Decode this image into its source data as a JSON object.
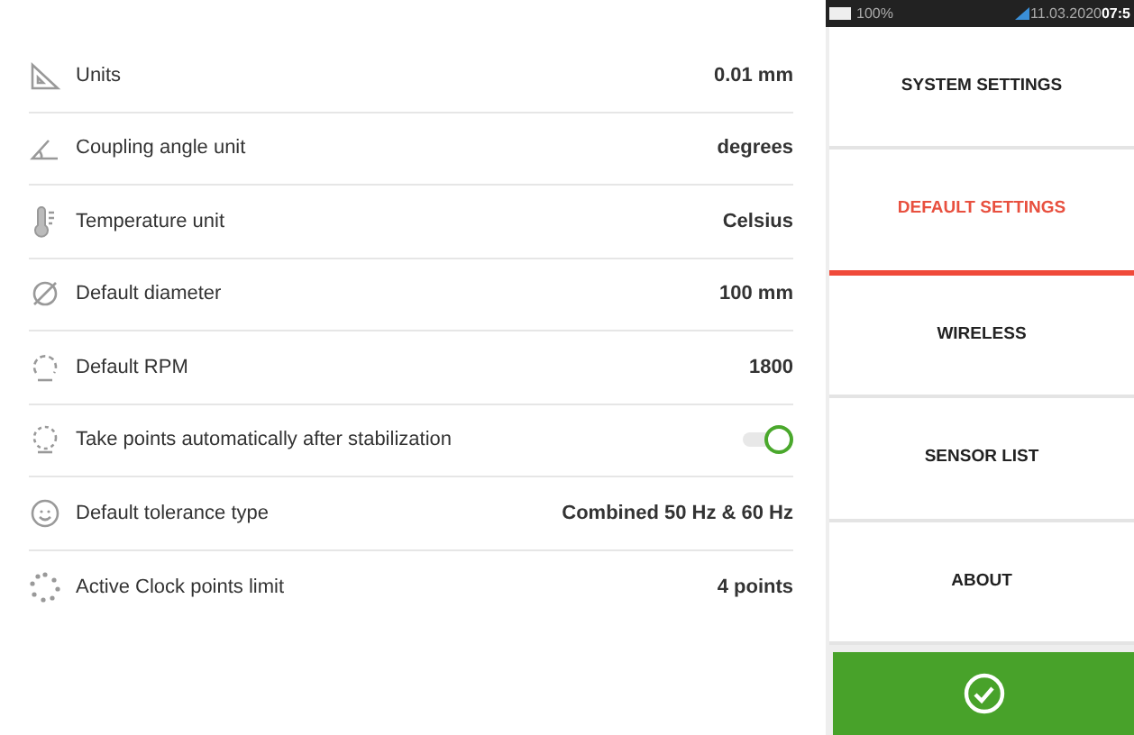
{
  "settings": [
    {
      "kind": "value",
      "label": "Units",
      "value": "0.01 mm"
    },
    {
      "kind": "value",
      "label": "Coupling angle unit",
      "value": "degrees"
    },
    {
      "kind": "value",
      "label": "Temperature unit",
      "value": "Celsius"
    },
    {
      "kind": "value",
      "label": "Default diameter",
      "value": "100 mm"
    },
    {
      "kind": "value",
      "label": "Default RPM",
      "value": "1800"
    },
    {
      "kind": "toggle",
      "label": "Take points automatically after stabilization",
      "on": true
    },
    {
      "kind": "value",
      "label": "Default tolerance type",
      "value": "Combined 50 Hz & 60 Hz"
    },
    {
      "kind": "value",
      "label": "Active Clock points limit",
      "value": "4 points"
    }
  ],
  "status_bar": {
    "battery": "100%",
    "date": "11.03.2020",
    "time": "07:5"
  },
  "menu": [
    {
      "label": "SYSTEM SETTINGS",
      "selected": false
    },
    {
      "label": "DEFAULT SETTINGS",
      "selected": true
    },
    {
      "label": "WIRELESS",
      "selected": false
    },
    {
      "label": "SENSOR LIST",
      "selected": false
    },
    {
      "label": "ABOUT",
      "selected": false
    }
  ]
}
